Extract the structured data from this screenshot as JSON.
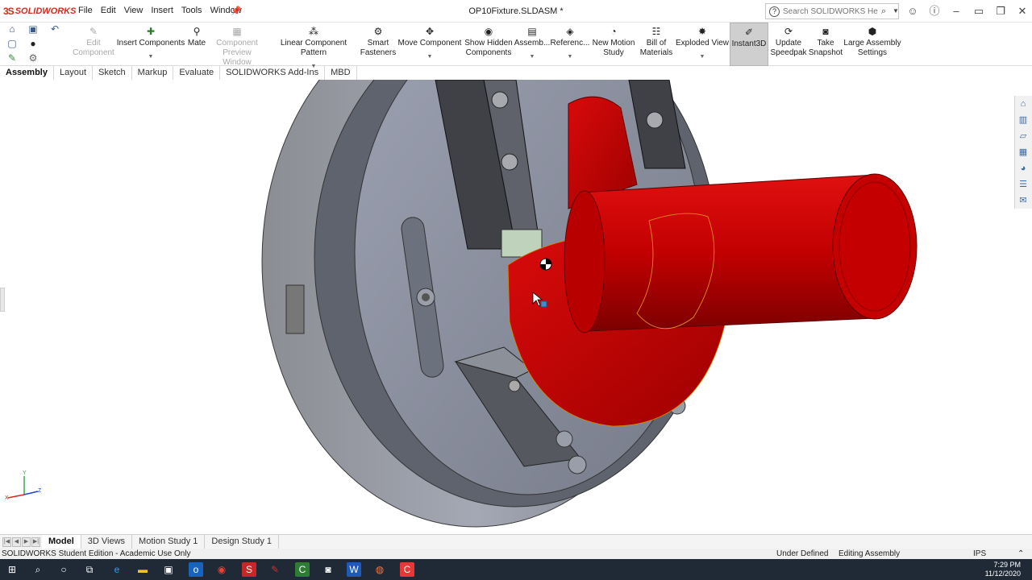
{
  "app": {
    "logo_prefix": "3S",
    "logo_text": "SOLIDWORKS",
    "document_title": "OP10Fixture.SLDASM *",
    "menus": [
      "File",
      "Edit",
      "View",
      "Insert",
      "Tools",
      "Window"
    ],
    "search_placeholder": "Search SOLIDWORKS Help",
    "search_help_glyph": "?",
    "icons": {
      "pin": "pin-icon",
      "search": "magnifier-icon",
      "account": "user-circle-icon",
      "help": "help-icon",
      "minimize": "minimize-icon",
      "restore": "restore-icon",
      "maximize": "maximize-icon",
      "close": "close-icon"
    }
  },
  "ribbon": {
    "buttons": [
      {
        "id": "edit-component",
        "label1": "Edit",
        "label2": "Component",
        "disabled": true,
        "icon": "edit-component-icon"
      },
      {
        "id": "insert-components",
        "label1": "Insert Components",
        "label2": "",
        "dropdown": true,
        "icon": "insert-components-icon"
      },
      {
        "id": "mate",
        "label1": "Mate",
        "label2": "",
        "icon": "paperclip-icon"
      },
      {
        "id": "component-preview",
        "label1": "Component",
        "label2": "Preview Window",
        "disabled": true,
        "icon": "preview-window-icon"
      },
      {
        "id": "linear-pattern",
        "label1": "Linear Component Pattern",
        "label2": "",
        "dropdown": true,
        "icon": "linear-pattern-icon"
      },
      {
        "id": "smart-fasteners",
        "label1": "Smart",
        "label2": "Fasteners",
        "icon": "fastener-icon"
      },
      {
        "id": "move-component",
        "label1": "Move Component",
        "label2": "",
        "dropdown": true,
        "icon": "move-component-icon"
      },
      {
        "id": "show-hidden",
        "label1": "Show Hidden",
        "label2": "Components",
        "icon": "show-hidden-icon"
      },
      {
        "id": "assembly",
        "label1": "Assemb...",
        "label2": "",
        "dropdown": true,
        "icon": "assembly-features-icon"
      },
      {
        "id": "reference",
        "label1": "Referenc...",
        "label2": "",
        "dropdown": true,
        "icon": "reference-geometry-icon"
      },
      {
        "id": "new-motion",
        "label1": "New Motion",
        "label2": "Study",
        "icon": "motion-study-icon"
      },
      {
        "id": "bom",
        "label1": "Bill of",
        "label2": "Materials",
        "icon": "bill-of-materials-icon"
      },
      {
        "id": "exploded",
        "label1": "Exploded View",
        "label2": "",
        "dropdown": true,
        "icon": "exploded-view-icon"
      },
      {
        "id": "instant3d",
        "label1": "Instant3D",
        "label2": "",
        "active": true,
        "icon": "instant3d-icon"
      },
      {
        "id": "speedpak",
        "label1": "Update",
        "label2": "Speedpak",
        "icon": "speedpak-icon"
      },
      {
        "id": "snapshot",
        "label1": "Take",
        "label2": "Snapshot",
        "icon": "camera-icon"
      },
      {
        "id": "large-assembly",
        "label1": "Large Assembly",
        "label2": "Settings",
        "icon": "large-assembly-icon"
      }
    ]
  },
  "command_tabs": [
    "Assembly",
    "Layout",
    "Sketch",
    "Markup",
    "Evaluate",
    "SOLIDWORKS Add-Ins",
    "MBD"
  ],
  "bottom_tabs": [
    "Model",
    "3D Views",
    "Motion Study 1",
    "Design Study 1"
  ],
  "status": {
    "left": "SOLIDWORKS Student Edition - Academic Use Only",
    "state": "Under Defined",
    "mode": "Editing Assembly",
    "units": "IPS"
  },
  "triad": {
    "y": "Y",
    "x": "X",
    "z": "Z"
  },
  "clock": {
    "time": "7:29 PM",
    "date": "11/12/2020"
  },
  "colors": {
    "accent_red": "#d52b1e",
    "part_red": "#c40000",
    "fixture_gray": "#8a8e99",
    "taskbar": "#1f2a36"
  }
}
